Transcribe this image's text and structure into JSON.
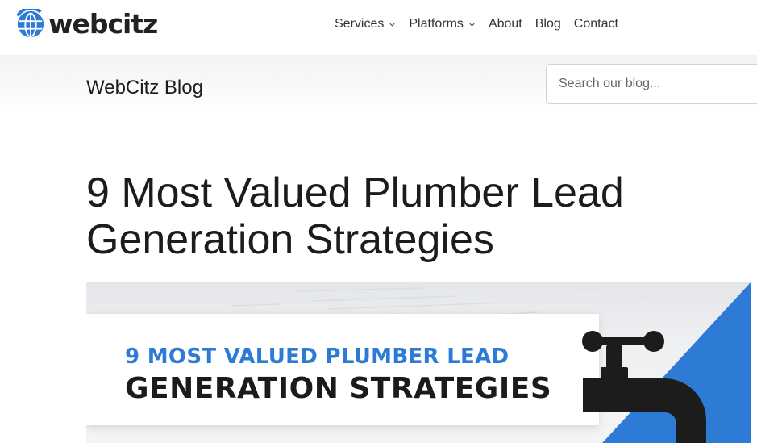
{
  "brand": {
    "name": "webcitz",
    "accent": "#2e7bd6"
  },
  "nav": {
    "items": [
      {
        "label": "Services",
        "has_dropdown": true
      },
      {
        "label": "Platforms",
        "has_dropdown": true
      },
      {
        "label": "About",
        "has_dropdown": false
      },
      {
        "label": "Blog",
        "has_dropdown": false
      },
      {
        "label": "Contact",
        "has_dropdown": false
      }
    ]
  },
  "blog_header": {
    "title": "WebCitz Blog",
    "search_placeholder": "Search our blog..."
  },
  "article": {
    "title_line1": "9 Most Valued Plumber Lead",
    "title_line2": "Generation Strategies",
    "hero": {
      "line1": "9 MOST VALUED PLUMBER LEAD",
      "line2": "GENERATION STRATEGIES",
      "icon": "faucet-icon"
    }
  }
}
